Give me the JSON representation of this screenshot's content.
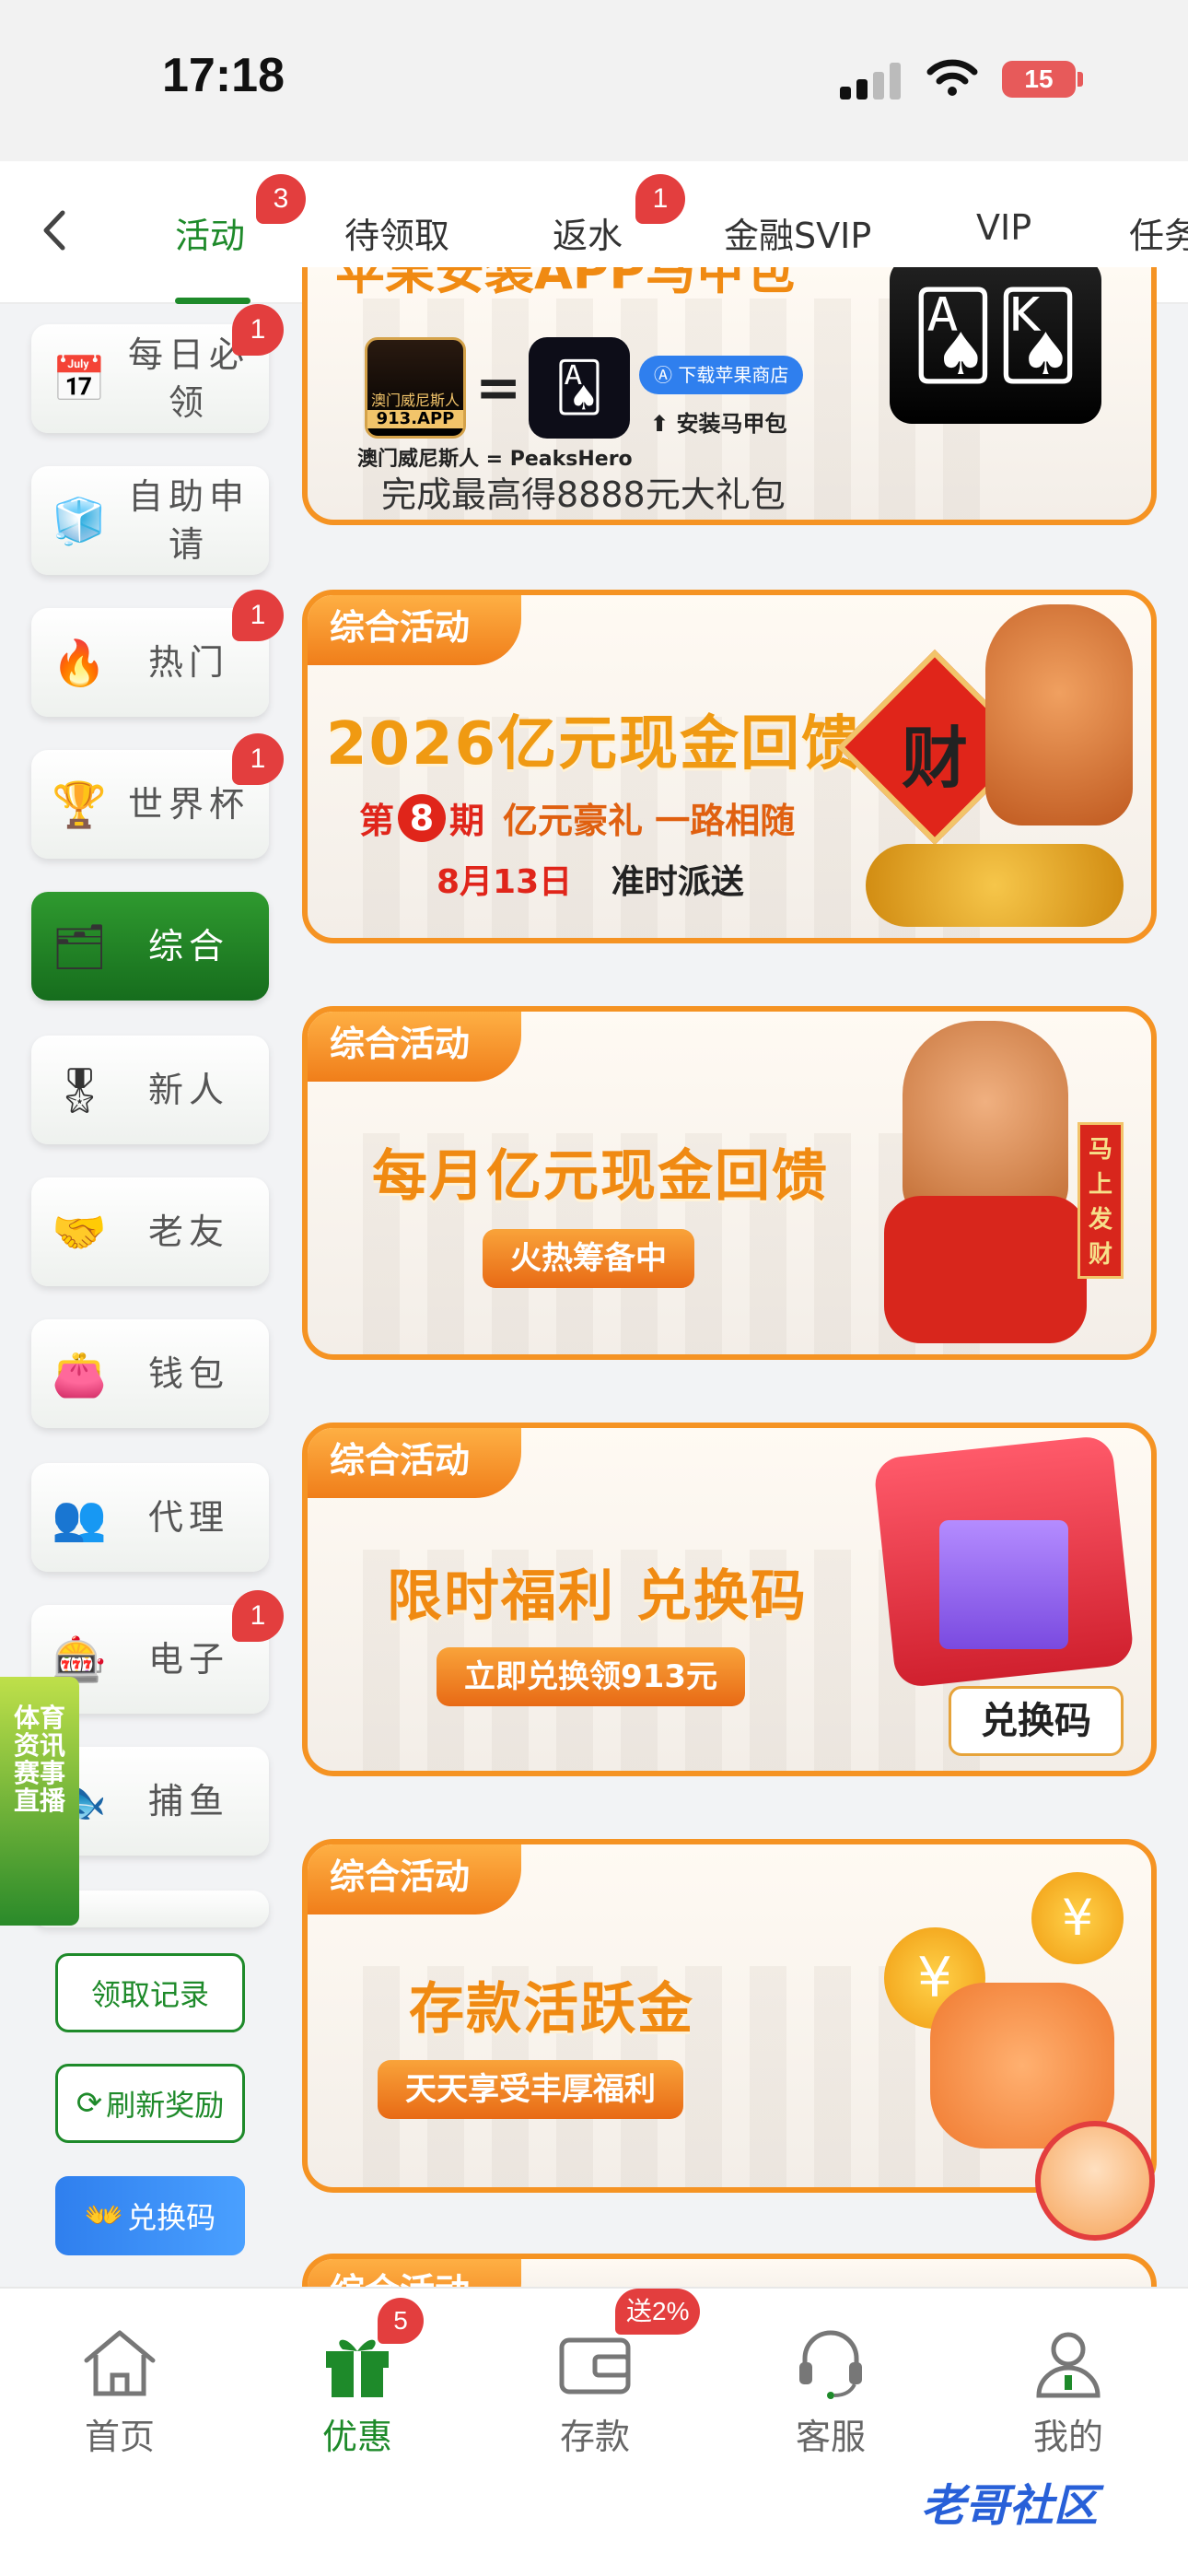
{
  "status": {
    "time": "17:18",
    "battery": "15"
  },
  "tabs": [
    {
      "label": "活动",
      "badge": "3"
    },
    {
      "label": "待领取"
    },
    {
      "label": "返水",
      "badge": "1"
    },
    {
      "label": "金融SVIP"
    },
    {
      "label": "VIP"
    },
    {
      "label": "任务"
    }
  ],
  "sidebar": {
    "items": [
      {
        "label": "每日必领",
        "badge": "1"
      },
      {
        "label": "自助申请"
      },
      {
        "label": "热门",
        "badge": "1"
      },
      {
        "label": "世界杯",
        "badge": "1"
      },
      {
        "label": "综合"
      },
      {
        "label": "新人"
      },
      {
        "label": "老友"
      },
      {
        "label": "钱包"
      },
      {
        "label": "代理"
      },
      {
        "label": "电子",
        "badge": "1"
      },
      {
        "label": "捕鱼"
      }
    ],
    "buttons": {
      "records": "领取记录",
      "refresh": "刷新奖励",
      "redeem": "兑换码"
    },
    "float_ad": "体育资讯赛事直播"
  },
  "banners": [
    {
      "top_line": "苹果安装APP马甲包",
      "brand": "澳门威尼斯人",
      "brand_url": "913.APP",
      "equals": "=",
      "app_name": "澳门威尼斯人 = PeaksHero",
      "store_btn": "下载苹果商店",
      "install": "安装马甲包",
      "bottom": "完成最高得8888元大礼包"
    },
    {
      "tag": "综合活动",
      "title": "2026亿元现金回馈",
      "line1_a": "第",
      "line1_num": "8",
      "line1_b": "期",
      "line1_c": "亿元豪礼 一路相随",
      "line2_date": "8月13日",
      "line2_text": "准时派送",
      "art": "财"
    },
    {
      "tag": "综合活动",
      "title": "每月亿元现金回馈",
      "pill": "火热筹备中",
      "art": "马上发财"
    },
    {
      "tag": "综合活动",
      "title": "限时福利 兑换码",
      "pill": "立即兑换领913元",
      "art": "兑换码"
    },
    {
      "tag": "综合活动",
      "title": "存款活跃金",
      "pill": "天天享受丰厚福利"
    },
    {
      "tag": "综合活动"
    }
  ],
  "bottom_nav": [
    {
      "label": "首页"
    },
    {
      "label": "优惠",
      "badge": "5"
    },
    {
      "label": "存款",
      "badge": "送2%"
    },
    {
      "label": "客服"
    },
    {
      "label": "我的"
    }
  ],
  "watermark": "老哥社区",
  "colors": {
    "accent": "#1e8a2a",
    "badge": "#e33e3e",
    "banner_border": "#f59323"
  }
}
